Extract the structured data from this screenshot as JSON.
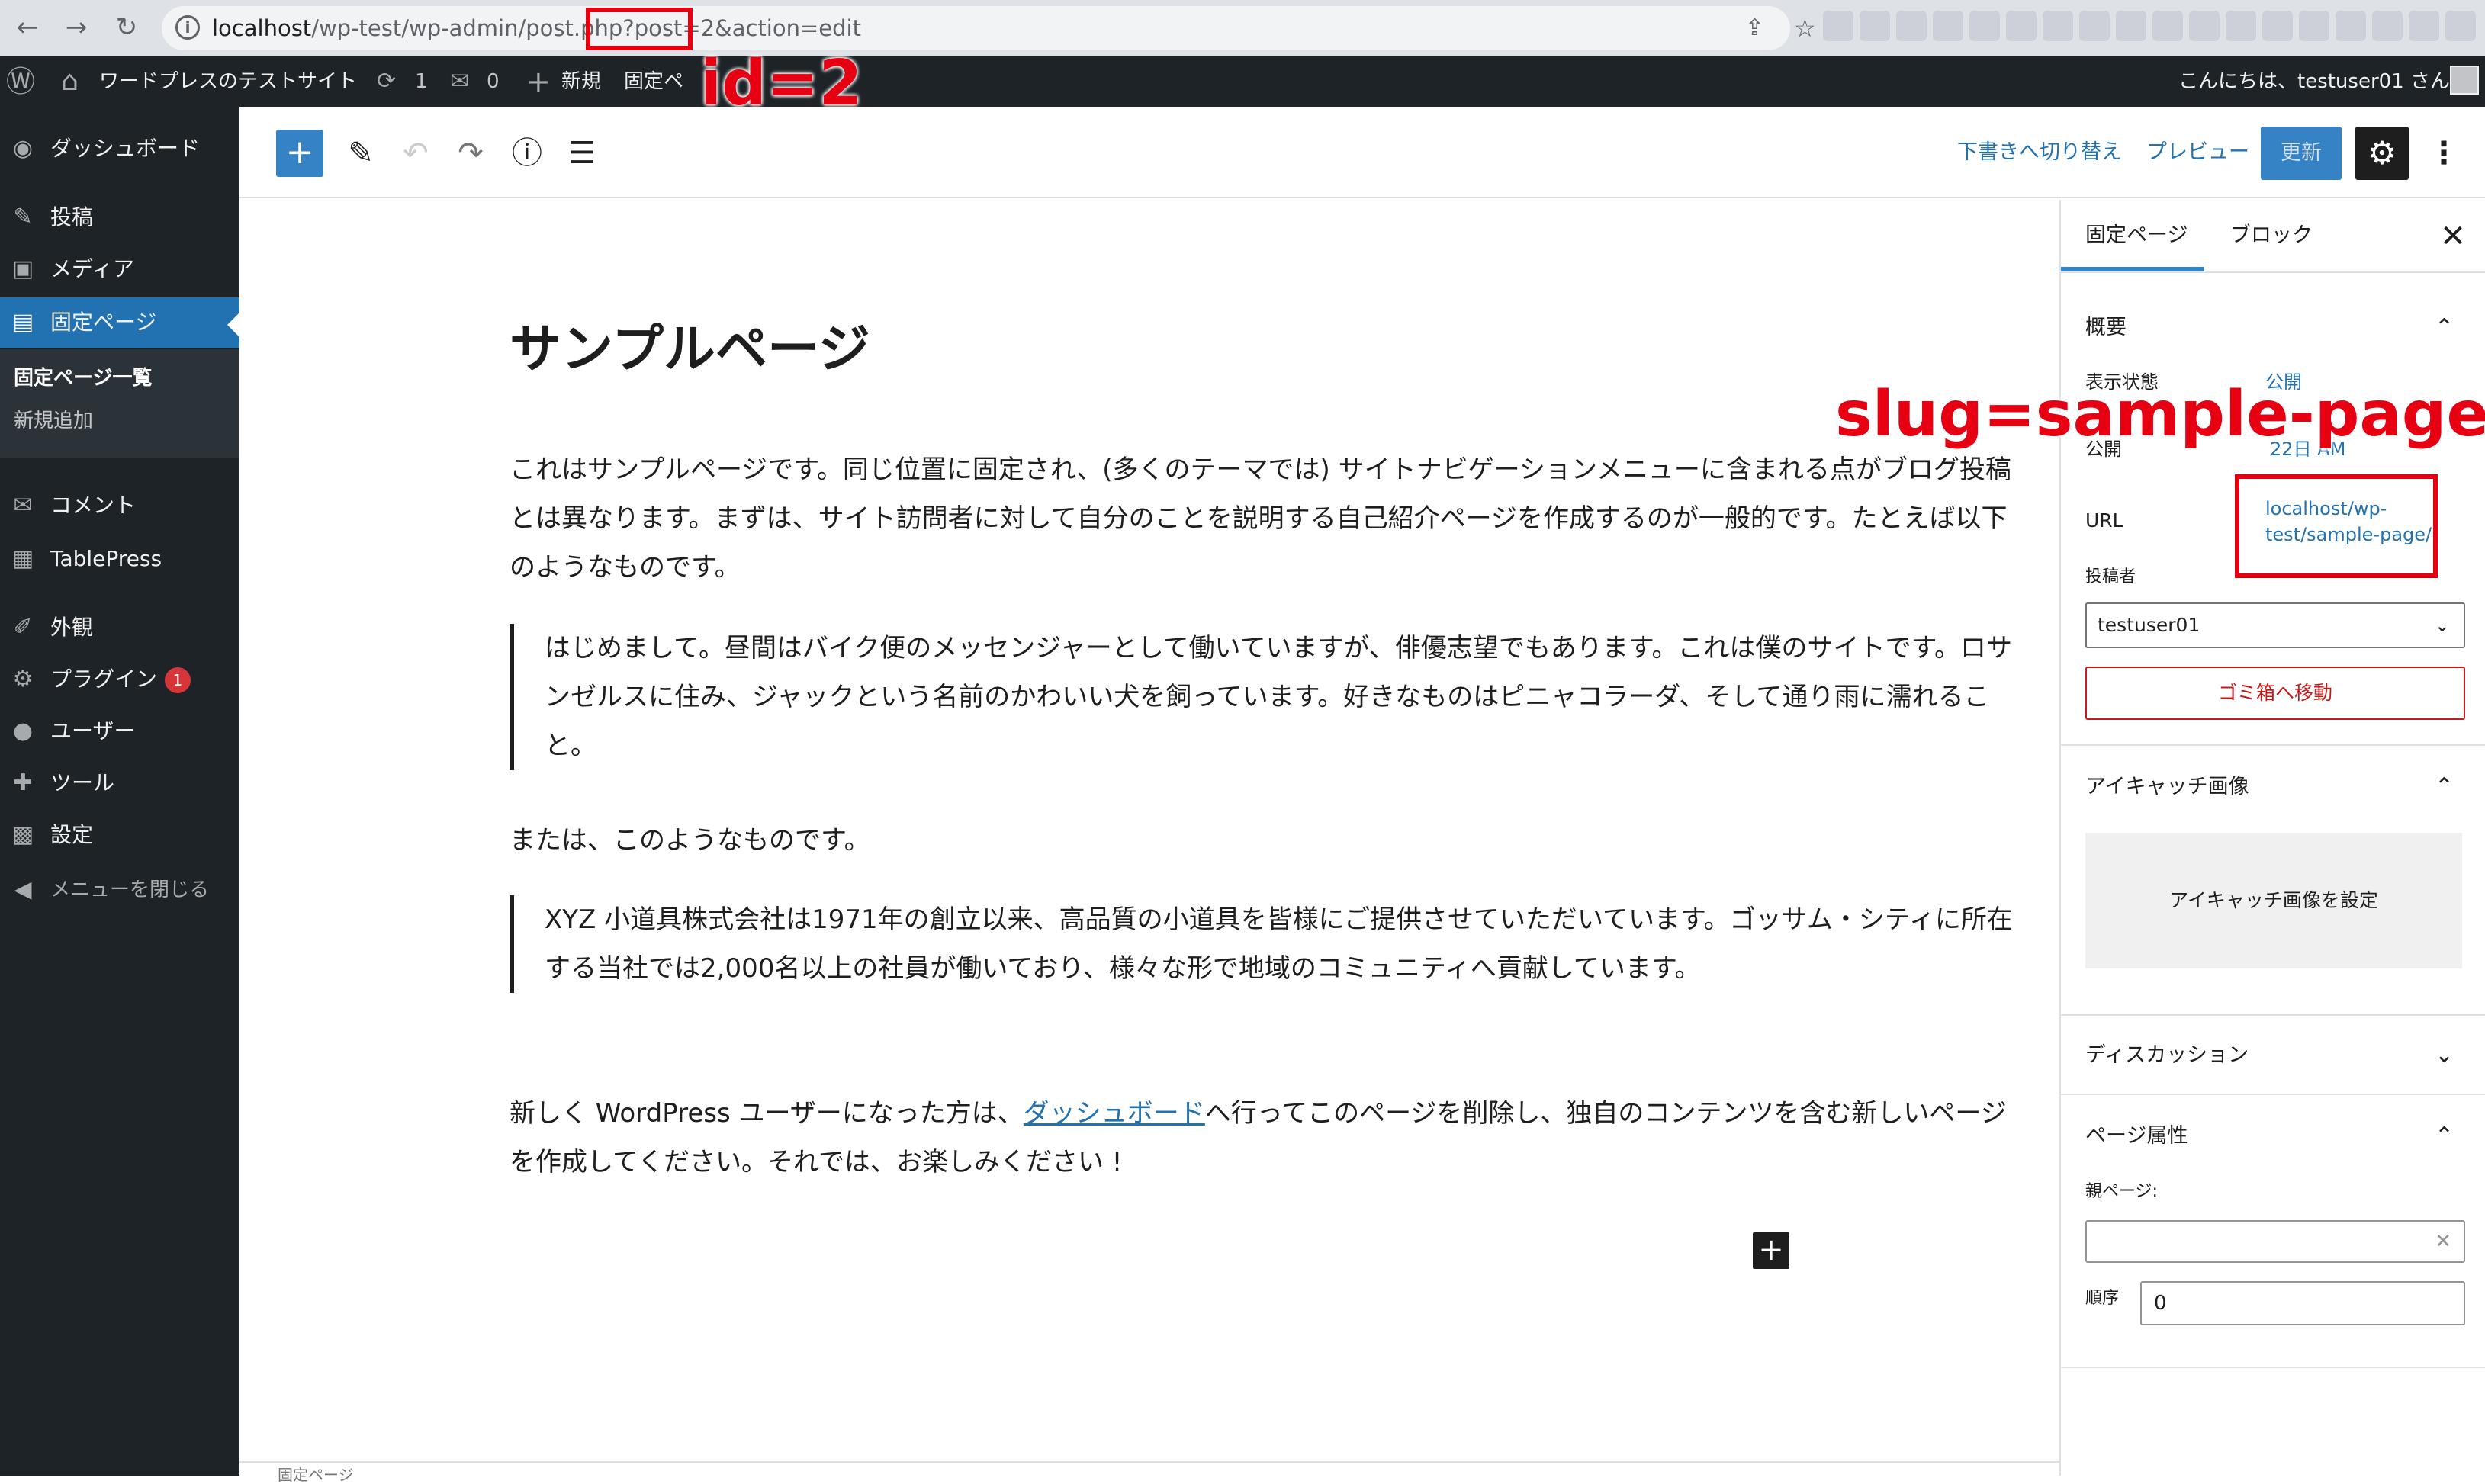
{
  "browser": {
    "url_host": "localhost",
    "url_path": "/wp-test/wp-admin/post.php",
    "url_query_a": "?post=2",
    "url_query_b": "&action=edit",
    "back_icon": "←",
    "forward_icon": "→",
    "reload_icon": "↻",
    "share_icon": "⇪",
    "star_icon": "☆"
  },
  "adminbar": {
    "wp_logo": "Ⓦ",
    "home_icon": "⌂",
    "site_name": "ワードプレスのテストサイト",
    "updates_icon": "⟳",
    "updates_count": "1",
    "comments_icon": "✉",
    "comments_count": "0",
    "new_icon": "+",
    "new_label": "新規",
    "page_label": "固定ペ",
    "greeting": "こんにちは、testuser01 さん"
  },
  "sidebar": {
    "items": [
      {
        "icon": "◉",
        "label": "ダッシュボード"
      },
      {
        "icon": "✎",
        "label": "投稿"
      },
      {
        "icon": "▣",
        "label": "メディア"
      },
      {
        "icon": "▤",
        "label": "固定ページ"
      },
      {
        "icon": "✉",
        "label": "コメント"
      },
      {
        "icon": "▦",
        "label": "TablePress"
      },
      {
        "icon": "✐",
        "label": "外観"
      },
      {
        "icon": "⚙",
        "label": "プラグイン"
      },
      {
        "icon": "●",
        "label": "ユーザー"
      },
      {
        "icon": "✚",
        "label": "ツール"
      },
      {
        "icon": "▩",
        "label": "設定"
      },
      {
        "icon": "◀",
        "label": "メニューを閉じる"
      }
    ],
    "plugins_badge": "1",
    "submenu": [
      "固定ページ一覧",
      "新規追加"
    ]
  },
  "toolbar": {
    "add_icon": "+",
    "edit_icon": "✎",
    "undo_icon": "↶",
    "redo_icon": "↷",
    "info_icon": "ⓘ",
    "list_icon": "☰",
    "switch_draft": "下書きへ切り替え",
    "preview": "プレビュー",
    "update": "更新",
    "settings_icon": "⚙",
    "more_icon": "⋮"
  },
  "content": {
    "title": "サンプルページ",
    "p1": "これはサンプルページです。同じ位置に固定され、(多くのテーマでは) サイトナビゲーションメニューに含まれる点がブログ投稿とは異なります。まずは、サイト訪問者に対して自分のことを説明する自己紹介ページを作成するのが一般的です。たとえば以下のようなものです。",
    "q1": "はじめまして。昼間はバイク便のメッセンジャーとして働いていますが、俳優志望でもあります。これは僕のサイトです。ロサンゼルスに住み、ジャックという名前のかわいい犬を飼っています。好きなものはピニャコラーダ、そして通り雨に濡れること。",
    "p2": "または、このようなものです。",
    "q2": "XYZ 小道具株式会社は1971年の創立以来、高品質の小道具を皆様にご提供させていただいています。ゴッサム・シティに所在する当社では2,000名以上の社員が働いており、様々な形で地域のコミュニティへ貢献しています。",
    "p3_before": "新しく WordPress ユーザーになった方は、",
    "p3_link": "ダッシュボード",
    "p3_after": "へ行ってこのページを削除し、独自のコンテンツを含む新しいページを作成してください。それでは、お楽しみください !",
    "inline_add": "+",
    "footer": "固定ページ"
  },
  "panel": {
    "tab_page": "固定ページ",
    "tab_block": "ブロック",
    "close_icon": "✕",
    "summary_title": "概要",
    "visibility_label": "表示状態",
    "visibility_value": "公開",
    "publish_label": "公開",
    "publish_value": "22日 AM",
    "url_label": "URL",
    "url_value_1": "localhost/wp-",
    "url_value_2": "test/sample-page/",
    "author_label": "投稿者",
    "author_value": "testuser01",
    "trash": "ゴミ箱へ移動",
    "featured_title": "アイキャッチ画像",
    "featured_button": "アイキャッチ画像を設定",
    "discussion_title": "ディスカッション",
    "attributes_title": "ページ属性",
    "parent_label": "親ページ:",
    "parent_clear": "✕",
    "order_label": "順序",
    "order_value": "0",
    "chevron_up": "⌃",
    "chevron_down": "⌄"
  },
  "annotations": {
    "id_note": "id=2",
    "slug_note": "slug=sample-page"
  },
  "colors": {
    "admin_dark": "#1d2327",
    "wp_blue": "#2271b1",
    "annotation_red": "#e60012"
  }
}
